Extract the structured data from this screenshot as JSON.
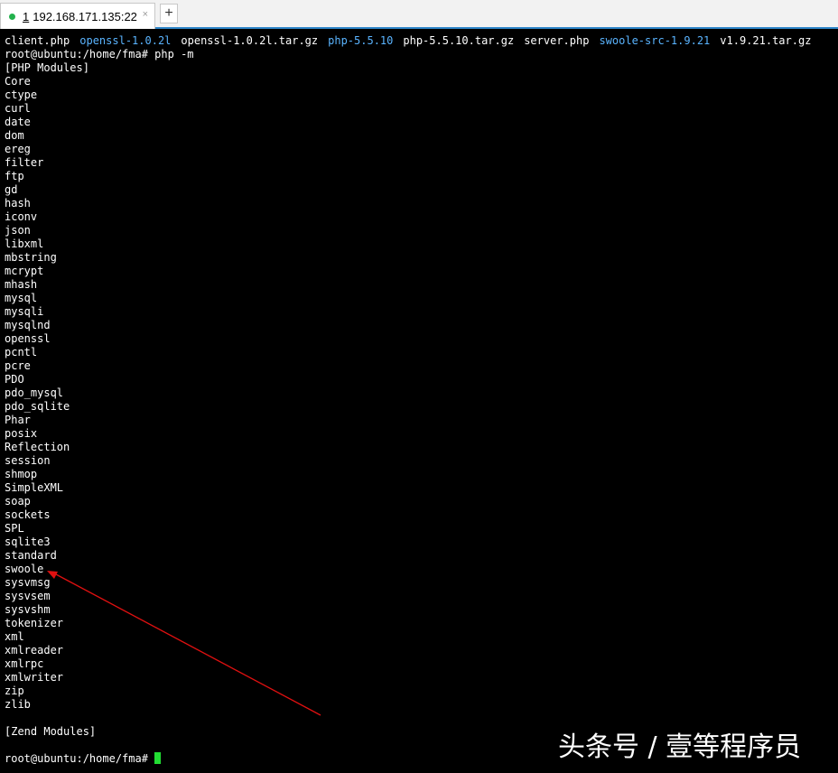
{
  "tab": {
    "number": "1",
    "title": "192.168.171.135:22",
    "close_glyph": "×",
    "add_glyph": "+"
  },
  "terminal": {
    "ls_output": [
      {
        "name": "client.php",
        "kind": "file"
      },
      {
        "name": "openssl-1.0.2l",
        "kind": "dir"
      },
      {
        "name": "openssl-1.0.2l.tar.gz",
        "kind": "archive"
      },
      {
        "name": "php-5.5.10",
        "kind": "dir"
      },
      {
        "name": "php-5.5.10.tar.gz",
        "kind": "archive"
      },
      {
        "name": "server.php",
        "kind": "file"
      },
      {
        "name": "swoole-src-1.9.21",
        "kind": "dir"
      },
      {
        "name": "v1.9.21.tar.gz",
        "kind": "archive"
      }
    ],
    "command_line": "root@ubuntu:/home/fma# php -m",
    "php_modules_header": "[PHP Modules]",
    "modules": [
      "Core",
      "ctype",
      "curl",
      "date",
      "dom",
      "ereg",
      "filter",
      "ftp",
      "gd",
      "hash",
      "iconv",
      "json",
      "libxml",
      "mbstring",
      "mcrypt",
      "mhash",
      "mysql",
      "mysqli",
      "mysqlnd",
      "openssl",
      "pcntl",
      "pcre",
      "PDO",
      "pdo_mysql",
      "pdo_sqlite",
      "Phar",
      "posix",
      "Reflection",
      "session",
      "shmop",
      "SimpleXML",
      "soap",
      "sockets",
      "SPL",
      "sqlite3",
      "standard",
      "swoole",
      "sysvmsg",
      "sysvsem",
      "sysvshm",
      "tokenizer",
      "xml",
      "xmlreader",
      "xmlrpc",
      "xmlwriter",
      "zip",
      "zlib"
    ],
    "zend_modules_header": "[Zend Modules]",
    "prompt": "root@ubuntu:/home/fma# "
  },
  "colors": {
    "directory": "#5ab4ff",
    "archive": "#ff5252",
    "cursor": "#22dd33",
    "annotation_arrow": "#e01010"
  },
  "annotation": {
    "target_module": "swoole"
  },
  "watermark": "头条号 / 壹等程序员"
}
